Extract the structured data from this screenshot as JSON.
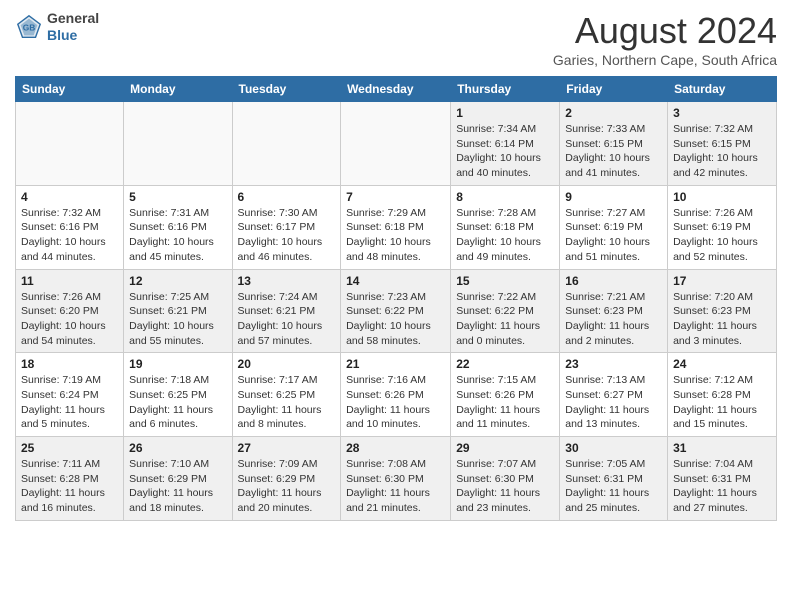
{
  "header": {
    "logo_general": "General",
    "logo_blue": "Blue",
    "month_title": "August 2024",
    "location": "Garies, Northern Cape, South Africa"
  },
  "days_of_week": [
    "Sunday",
    "Monday",
    "Tuesday",
    "Wednesday",
    "Thursday",
    "Friday",
    "Saturday"
  ],
  "weeks": [
    [
      {
        "day": "",
        "info": ""
      },
      {
        "day": "",
        "info": ""
      },
      {
        "day": "",
        "info": ""
      },
      {
        "day": "",
        "info": ""
      },
      {
        "day": "1",
        "info": "Sunrise: 7:34 AM\nSunset: 6:14 PM\nDaylight: 10 hours\nand 40 minutes."
      },
      {
        "day": "2",
        "info": "Sunrise: 7:33 AM\nSunset: 6:15 PM\nDaylight: 10 hours\nand 41 minutes."
      },
      {
        "day": "3",
        "info": "Sunrise: 7:32 AM\nSunset: 6:15 PM\nDaylight: 10 hours\nand 42 minutes."
      }
    ],
    [
      {
        "day": "4",
        "info": "Sunrise: 7:32 AM\nSunset: 6:16 PM\nDaylight: 10 hours\nand 44 minutes."
      },
      {
        "day": "5",
        "info": "Sunrise: 7:31 AM\nSunset: 6:16 PM\nDaylight: 10 hours\nand 45 minutes."
      },
      {
        "day": "6",
        "info": "Sunrise: 7:30 AM\nSunset: 6:17 PM\nDaylight: 10 hours\nand 46 minutes."
      },
      {
        "day": "7",
        "info": "Sunrise: 7:29 AM\nSunset: 6:18 PM\nDaylight: 10 hours\nand 48 minutes."
      },
      {
        "day": "8",
        "info": "Sunrise: 7:28 AM\nSunset: 6:18 PM\nDaylight: 10 hours\nand 49 minutes."
      },
      {
        "day": "9",
        "info": "Sunrise: 7:27 AM\nSunset: 6:19 PM\nDaylight: 10 hours\nand 51 minutes."
      },
      {
        "day": "10",
        "info": "Sunrise: 7:26 AM\nSunset: 6:19 PM\nDaylight: 10 hours\nand 52 minutes."
      }
    ],
    [
      {
        "day": "11",
        "info": "Sunrise: 7:26 AM\nSunset: 6:20 PM\nDaylight: 10 hours\nand 54 minutes."
      },
      {
        "day": "12",
        "info": "Sunrise: 7:25 AM\nSunset: 6:21 PM\nDaylight: 10 hours\nand 55 minutes."
      },
      {
        "day": "13",
        "info": "Sunrise: 7:24 AM\nSunset: 6:21 PM\nDaylight: 10 hours\nand 57 minutes."
      },
      {
        "day": "14",
        "info": "Sunrise: 7:23 AM\nSunset: 6:22 PM\nDaylight: 10 hours\nand 58 minutes."
      },
      {
        "day": "15",
        "info": "Sunrise: 7:22 AM\nSunset: 6:22 PM\nDaylight: 11 hours\nand 0 minutes."
      },
      {
        "day": "16",
        "info": "Sunrise: 7:21 AM\nSunset: 6:23 PM\nDaylight: 11 hours\nand 2 minutes."
      },
      {
        "day": "17",
        "info": "Sunrise: 7:20 AM\nSunset: 6:23 PM\nDaylight: 11 hours\nand 3 minutes."
      }
    ],
    [
      {
        "day": "18",
        "info": "Sunrise: 7:19 AM\nSunset: 6:24 PM\nDaylight: 11 hours\nand 5 minutes."
      },
      {
        "day": "19",
        "info": "Sunrise: 7:18 AM\nSunset: 6:25 PM\nDaylight: 11 hours\nand 6 minutes."
      },
      {
        "day": "20",
        "info": "Sunrise: 7:17 AM\nSunset: 6:25 PM\nDaylight: 11 hours\nand 8 minutes."
      },
      {
        "day": "21",
        "info": "Sunrise: 7:16 AM\nSunset: 6:26 PM\nDaylight: 11 hours\nand 10 minutes."
      },
      {
        "day": "22",
        "info": "Sunrise: 7:15 AM\nSunset: 6:26 PM\nDaylight: 11 hours\nand 11 minutes."
      },
      {
        "day": "23",
        "info": "Sunrise: 7:13 AM\nSunset: 6:27 PM\nDaylight: 11 hours\nand 13 minutes."
      },
      {
        "day": "24",
        "info": "Sunrise: 7:12 AM\nSunset: 6:28 PM\nDaylight: 11 hours\nand 15 minutes."
      }
    ],
    [
      {
        "day": "25",
        "info": "Sunrise: 7:11 AM\nSunset: 6:28 PM\nDaylight: 11 hours\nand 16 minutes."
      },
      {
        "day": "26",
        "info": "Sunrise: 7:10 AM\nSunset: 6:29 PM\nDaylight: 11 hours\nand 18 minutes."
      },
      {
        "day": "27",
        "info": "Sunrise: 7:09 AM\nSunset: 6:29 PM\nDaylight: 11 hours\nand 20 minutes."
      },
      {
        "day": "28",
        "info": "Sunrise: 7:08 AM\nSunset: 6:30 PM\nDaylight: 11 hours\nand 21 minutes."
      },
      {
        "day": "29",
        "info": "Sunrise: 7:07 AM\nSunset: 6:30 PM\nDaylight: 11 hours\nand 23 minutes."
      },
      {
        "day": "30",
        "info": "Sunrise: 7:05 AM\nSunset: 6:31 PM\nDaylight: 11 hours\nand 25 minutes."
      },
      {
        "day": "31",
        "info": "Sunrise: 7:04 AM\nSunset: 6:31 PM\nDaylight: 11 hours\nand 27 minutes."
      }
    ]
  ]
}
